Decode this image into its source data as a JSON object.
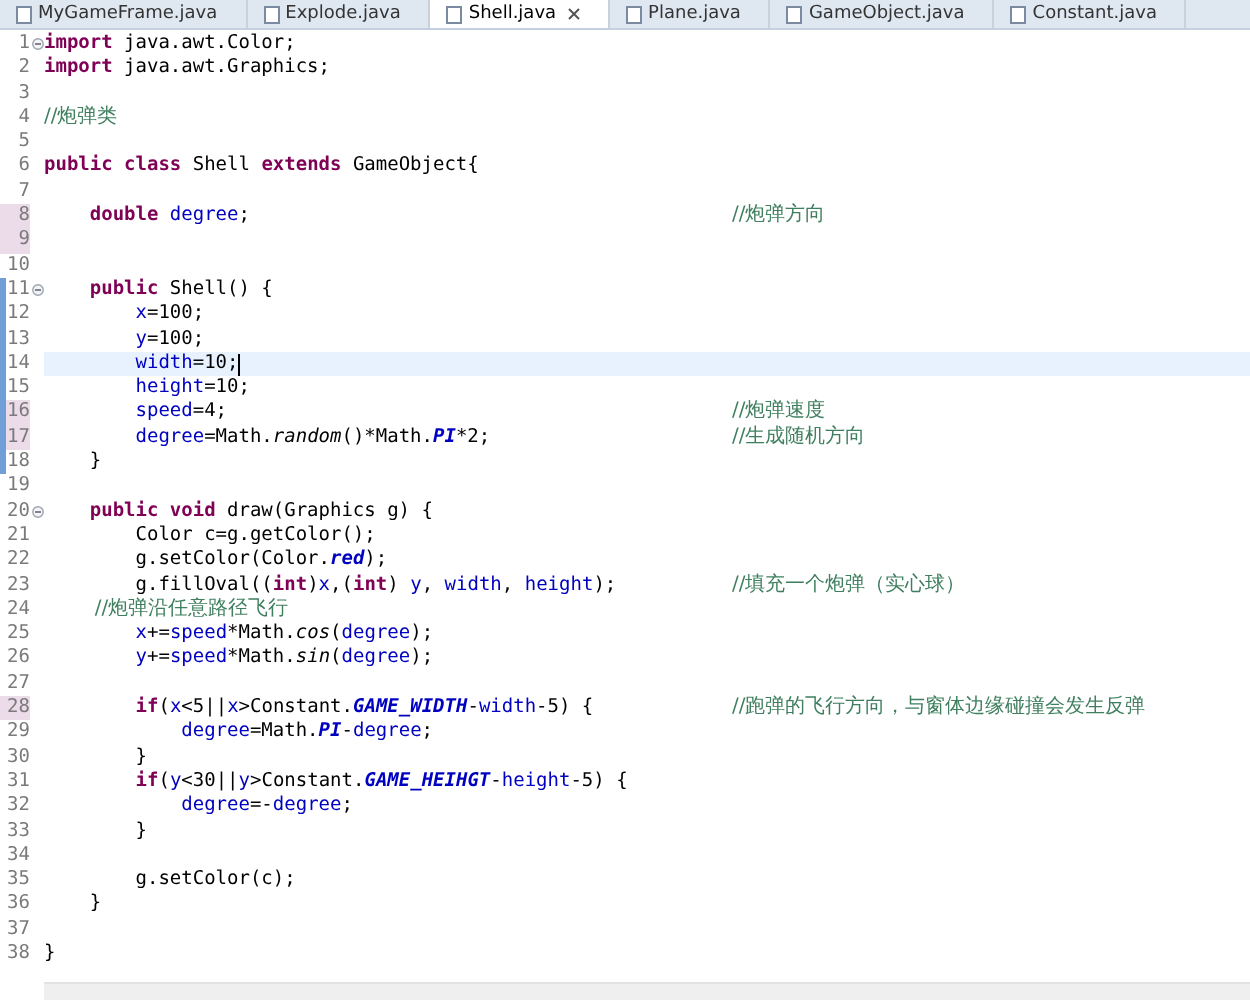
{
  "tabs": [
    {
      "label": "MyGameFrame.java",
      "selected": false
    },
    {
      "label": "Explode.java",
      "selected": false
    },
    {
      "label": "Shell.java",
      "selected": true
    },
    {
      "label": "Plane.java",
      "selected": false
    },
    {
      "label": "GameObject.java",
      "selected": false
    },
    {
      "label": "Constant.java",
      "selected": false
    }
  ],
  "lines": [
    {
      "number": "1",
      "fold": true,
      "marked": false,
      "changed": false,
      "current": false,
      "tokens": [
        {
          "kind": "keyword",
          "text": "import"
        },
        {
          "kind": "plain",
          "text": " java.awt.Color;"
        }
      ]
    },
    {
      "number": "2",
      "fold": false,
      "marked": false,
      "changed": false,
      "current": false,
      "tokens": [
        {
          "kind": "keyword",
          "text": "import"
        },
        {
          "kind": "plain",
          "text": " java.awt.Graphics;"
        }
      ]
    },
    {
      "number": "3",
      "fold": false,
      "marked": false,
      "changed": false,
      "current": false
    },
    {
      "number": "4",
      "fold": false,
      "marked": false,
      "changed": false,
      "current": false,
      "tokens": [
        {
          "kind": "comment",
          "text": "//炮弹类"
        }
      ]
    },
    {
      "number": "5",
      "fold": false,
      "marked": false,
      "changed": false,
      "current": false
    },
    {
      "number": "6",
      "fold": false,
      "marked": false,
      "changed": false,
      "current": false,
      "tokens": [
        {
          "kind": "keyword",
          "text": "public class"
        },
        {
          "kind": "plain",
          "text": " Shell "
        },
        {
          "kind": "keyword",
          "text": "extends"
        },
        {
          "kind": "plain",
          "text": " GameObject{"
        }
      ]
    },
    {
      "number": "7",
      "fold": false,
      "marked": false,
      "changed": false,
      "current": false
    },
    {
      "number": "8",
      "fold": false,
      "marked": true,
      "changed": false,
      "current": false,
      "tokens": [
        {
          "kind": "keyword",
          "text": "    double "
        },
        {
          "kind": "field",
          "text": "degree"
        },
        {
          "kind": "plain",
          "text": ";"
        }
      ],
      "comment": "//炮弹方向"
    },
    {
      "number": "9",
      "fold": false,
      "marked": true,
      "changed": false,
      "current": false
    },
    {
      "number": "10",
      "fold": false,
      "marked": false,
      "changed": false,
      "current": false
    },
    {
      "number": "11",
      "fold": true,
      "marked": false,
      "changed": true,
      "current": false,
      "tokens": [
        {
          "kind": "keyword",
          "text": "    public"
        },
        {
          "kind": "plain",
          "text": " Shell() {"
        }
      ]
    },
    {
      "number": "12",
      "fold": false,
      "marked": false,
      "changed": true,
      "current": false,
      "tokens": [
        {
          "kind": "field",
          "text": "        x"
        },
        {
          "kind": "plain",
          "text": "=100;"
        }
      ]
    },
    {
      "number": "13",
      "fold": false,
      "marked": false,
      "changed": true,
      "current": false,
      "tokens": [
        {
          "kind": "field",
          "text": "        y"
        },
        {
          "kind": "plain",
          "text": "=100;"
        }
      ]
    },
    {
      "number": "14",
      "fold": false,
      "marked": false,
      "changed": true,
      "current": true,
      "tokens": [
        {
          "kind": "field",
          "text": "        width"
        },
        {
          "kind": "plain",
          "text": "=10;"
        }
      ]
    },
    {
      "number": "15",
      "fold": false,
      "marked": false,
      "changed": true,
      "current": false,
      "tokens": [
        {
          "kind": "field",
          "text": "        height"
        },
        {
          "kind": "plain",
          "text": "=10;"
        }
      ]
    },
    {
      "number": "16",
      "fold": false,
      "marked": true,
      "changed": true,
      "current": false,
      "tokens": [
        {
          "kind": "field",
          "text": "        speed"
        },
        {
          "kind": "plain",
          "text": "=4;"
        }
      ],
      "comment": "//炮弹速度"
    },
    {
      "number": "17",
      "fold": false,
      "marked": true,
      "changed": true,
      "current": false,
      "tokens": [
        {
          "kind": "field",
          "text": "        degree"
        },
        {
          "kind": "plain",
          "text": "=Math."
        },
        {
          "kind": "static-method",
          "text": "random"
        },
        {
          "kind": "plain",
          "text": "()*Math."
        },
        {
          "kind": "constant",
          "text": "PI"
        },
        {
          "kind": "plain",
          "text": "*2;"
        }
      ],
      "comment": "//生成随机方向"
    },
    {
      "number": "18",
      "fold": false,
      "marked": false,
      "changed": true,
      "current": false,
      "tokens": [
        {
          "kind": "plain",
          "text": "    }"
        }
      ]
    },
    {
      "number": "19",
      "fold": false,
      "marked": false,
      "changed": false,
      "current": false
    },
    {
      "number": "20",
      "fold": true,
      "marked": false,
      "changed": false,
      "current": false,
      "tokens": [
        {
          "kind": "keyword",
          "text": "    public void"
        },
        {
          "kind": "plain",
          "text": " draw(Graphics g) {"
        }
      ]
    },
    {
      "number": "21",
      "fold": false,
      "marked": false,
      "changed": false,
      "current": false,
      "tokens": [
        {
          "kind": "plain",
          "text": "        Color c=g.getColor();"
        }
      ]
    },
    {
      "number": "22",
      "fold": false,
      "marked": false,
      "changed": false,
      "current": false,
      "tokens": [
        {
          "kind": "plain",
          "text": "        g.setColor(Color."
        },
        {
          "kind": "constant",
          "text": "red"
        },
        {
          "kind": "plain",
          "text": ");"
        }
      ]
    },
    {
      "number": "23",
      "fold": false,
      "marked": false,
      "changed": false,
      "current": false,
      "tokens": [
        {
          "kind": "plain",
          "text": "        g.fillOval(("
        },
        {
          "kind": "keyword",
          "text": "int"
        },
        {
          "kind": "plain",
          "text": ")"
        },
        {
          "kind": "field",
          "text": "x"
        },
        {
          "kind": "plain",
          "text": ",("
        },
        {
          "kind": "keyword",
          "text": "int"
        },
        {
          "kind": "plain",
          "text": ")"
        },
        {
          "kind": "field",
          "text": " y"
        },
        {
          "kind": "plain",
          "text": ","
        },
        {
          "kind": "field",
          "text": " width"
        },
        {
          "kind": "plain",
          "text": ","
        },
        {
          "kind": "field",
          "text": " height"
        },
        {
          "kind": "plain",
          "text": ");"
        }
      ],
      "comment": "//填充一个炮弹（实心球）"
    },
    {
      "number": "24",
      "fold": false,
      "marked": false,
      "changed": false,
      "current": false,
      "tokens": [
        {
          "kind": "comment",
          "text": "        //炮弹沿任意路径飞行"
        }
      ]
    },
    {
      "number": "25",
      "fold": false,
      "marked": false,
      "changed": false,
      "current": false,
      "tokens": [
        {
          "kind": "field",
          "text": "        x"
        },
        {
          "kind": "plain",
          "text": "+="
        },
        {
          "kind": "field",
          "text": "speed"
        },
        {
          "kind": "plain",
          "text": "*Math."
        },
        {
          "kind": "static-method",
          "text": "cos"
        },
        {
          "kind": "plain",
          "text": "("
        },
        {
          "kind": "field",
          "text": "degree"
        },
        {
          "kind": "plain",
          "text": ");"
        }
      ]
    },
    {
      "number": "26",
      "fold": false,
      "marked": false,
      "changed": false,
      "current": false,
      "tokens": [
        {
          "kind": "field",
          "text": "        y"
        },
        {
          "kind": "plain",
          "text": "+="
        },
        {
          "kind": "field",
          "text": "speed"
        },
        {
          "kind": "plain",
          "text": "*Math."
        },
        {
          "kind": "static-method",
          "text": "sin"
        },
        {
          "kind": "plain",
          "text": "("
        },
        {
          "kind": "field",
          "text": "degree"
        },
        {
          "kind": "plain",
          "text": ");"
        }
      ]
    },
    {
      "number": "27",
      "fold": false,
      "marked": false,
      "changed": false,
      "current": false
    },
    {
      "number": "28",
      "fold": false,
      "marked": true,
      "changed": false,
      "current": false,
      "tokens": [
        {
          "kind": "keyword",
          "text": "        if"
        },
        {
          "kind": "plain",
          "text": "("
        },
        {
          "kind": "field",
          "text": "x"
        },
        {
          "kind": "plain",
          "text": "<5||"
        },
        {
          "kind": "field",
          "text": "x"
        },
        {
          "kind": "plain",
          "text": ">Constant."
        },
        {
          "kind": "constant",
          "text": "GAME_WIDTH"
        },
        {
          "kind": "plain",
          "text": "-"
        },
        {
          "kind": "field",
          "text": "width"
        },
        {
          "kind": "plain",
          "text": "-5) {"
        }
      ],
      "comment": "//跑弹的飞行方向，与窗体边缘碰撞会发生反弹"
    },
    {
      "number": "29",
      "fold": false,
      "marked": false,
      "changed": false,
      "current": false,
      "tokens": [
        {
          "kind": "field",
          "text": "            degree"
        },
        {
          "kind": "plain",
          "text": "=Math."
        },
        {
          "kind": "constant",
          "text": "PI"
        },
        {
          "kind": "plain",
          "text": "-"
        },
        {
          "kind": "field",
          "text": "degree"
        },
        {
          "kind": "plain",
          "text": ";"
        }
      ]
    },
    {
      "number": "30",
      "fold": false,
      "marked": false,
      "changed": false,
      "current": false,
      "tokens": [
        {
          "kind": "plain",
          "text": "        }"
        }
      ]
    },
    {
      "number": "31",
      "fold": false,
      "marked": false,
      "changed": false,
      "current": false,
      "tokens": [
        {
          "kind": "keyword",
          "text": "        if"
        },
        {
          "kind": "plain",
          "text": "("
        },
        {
          "kind": "field",
          "text": "y"
        },
        {
          "kind": "plain",
          "text": "<30||"
        },
        {
          "kind": "field",
          "text": "y"
        },
        {
          "kind": "plain",
          "text": ">Constant."
        },
        {
          "kind": "constant",
          "text": "GAME_HEIHGT"
        },
        {
          "kind": "plain",
          "text": "-"
        },
        {
          "kind": "field",
          "text": "height"
        },
        {
          "kind": "plain",
          "text": "-5) {"
        }
      ]
    },
    {
      "number": "32",
      "fold": false,
      "marked": false,
      "changed": false,
      "current": false,
      "tokens": [
        {
          "kind": "field",
          "text": "            degree"
        },
        {
          "kind": "plain",
          "text": "=-"
        },
        {
          "kind": "field",
          "text": "degree"
        },
        {
          "kind": "plain",
          "text": ";"
        }
      ]
    },
    {
      "number": "33",
      "fold": false,
      "marked": false,
      "changed": false,
      "current": false,
      "tokens": [
        {
          "kind": "plain",
          "text": "        }"
        }
      ]
    },
    {
      "number": "34",
      "fold": false,
      "marked": false,
      "changed": false,
      "current": false
    },
    {
      "number": "35",
      "fold": false,
      "marked": false,
      "changed": false,
      "current": false,
      "tokens": [
        {
          "kind": "plain",
          "text": "        g.setColor(c);"
        }
      ]
    },
    {
      "number": "36",
      "fold": false,
      "marked": false,
      "changed": false,
      "current": false,
      "tokens": [
        {
          "kind": "plain",
          "text": "    }"
        }
      ]
    },
    {
      "number": "37",
      "fold": false,
      "marked": false,
      "changed": false,
      "current": false
    },
    {
      "number": "38",
      "fold": false,
      "marked": false,
      "changed": false,
      "current": false,
      "tokens": [
        {
          "kind": "plain",
          "text": "}"
        }
      ]
    }
  ]
}
